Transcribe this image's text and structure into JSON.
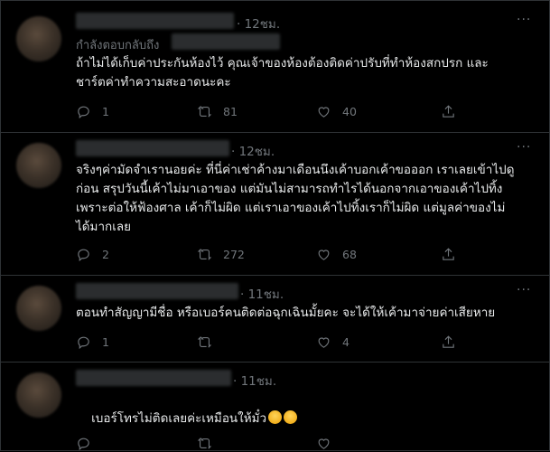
{
  "tweets": [
    {
      "time": "· 12ชม.",
      "reply_to_label": "กำลังตอบกลับถึง",
      "text": "ถ้าไม่ได้เก็บค่าประกันห้องไว้ คุณเจ้าของห้องต้องติดค่าปรับที่ทำห้องสกปรก และ\nชาร์ตค่าทำความสะอาดนะคะ",
      "reply_count": "1",
      "retweet_count": "81",
      "like_count": "40"
    },
    {
      "time": "· 12ชม.",
      "text": "จริงๆค่ามัดจำเรานอยค่ะ ที่นี่ค่าเช่าค้างมาเดือนนึงเค้าบอกเค้าขอออก เราเลยเข้าไปดู\nก่อน สรุปวันนี้เค้าไม่มาเอาของ แต่มันไม่สามารถทำไรได้นอกจากเอาของเค้าไปทิ้ง\nเพราะต่อให้ฟ้องศาล เค้าก็ไม่ผิด แต่เราเอาของเค้าไปทิ้งเราก็ไม่ผิด แต่มูลค่าของไม่\nได้มากเลย",
      "reply_count": "2",
      "retweet_count": "272",
      "like_count": "68"
    },
    {
      "time": "· 11ชม.",
      "text": "ตอนทำสัญญามีชื่อ หรือเบอร์คนติดต่อฉุกเฉินมั้ยคะ จะได้ให้เค้ามาจ่ายค่าเสียหาย",
      "reply_count": "1",
      "retweet_count": "",
      "like_count": "4"
    },
    {
      "time": "· 11ชม.",
      "text": "เบอร์โทรไม่ติดเลยค่ะเหมือนให้มั๋ว",
      "emoji_icons": [
        "hugging-face-icon",
        "pleading-face-icon"
      ],
      "reply_count": "",
      "retweet_count": "",
      "like_count": ""
    }
  ],
  "colors": {
    "background": "#000000",
    "text": "#e7e9ea",
    "muted": "#71767b",
    "divider": "#2f3336"
  },
  "icons": [
    "reply-icon",
    "retweet-icon",
    "like-icon",
    "share-icon",
    "more-icon"
  ]
}
